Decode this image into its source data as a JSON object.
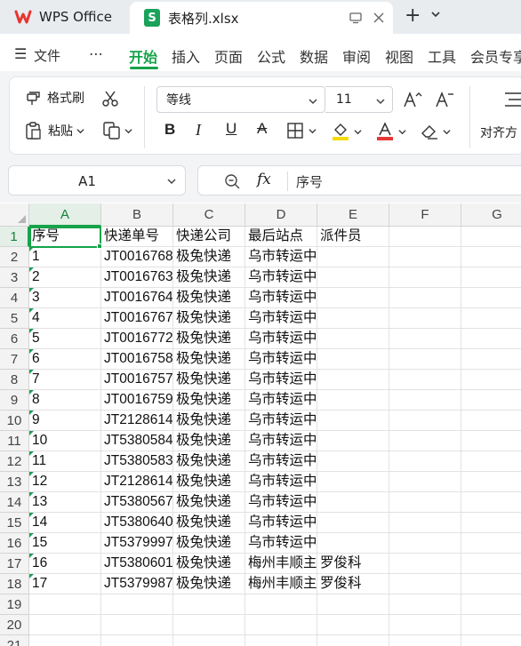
{
  "titlebar": {
    "home_label": "WPS Office",
    "file_tab_label": "表格列.xlsx",
    "sheet_icon_letter": "S"
  },
  "menu": {
    "hamburger": "☰",
    "file": "文件",
    "more": "⋯",
    "items": [
      "开始",
      "插入",
      "页面",
      "公式",
      "数据",
      "审阅",
      "视图",
      "工具",
      "会员专享"
    ],
    "active": "开始"
  },
  "ribbon": {
    "format_painter": "格式刷",
    "paste": "粘贴",
    "font_name": "等线",
    "font_size": "11",
    "bold": "B",
    "italic": "I",
    "underline": "U",
    "strike": "A",
    "align": "对齐方"
  },
  "formula_bar": {
    "cell_ref": "A1",
    "fx": "fx",
    "value": "序号"
  },
  "grid": {
    "columns": [
      "A",
      "B",
      "C",
      "D",
      "E",
      "F",
      "G"
    ],
    "rows": [
      "1",
      "2",
      "3",
      "4",
      "5",
      "6",
      "7",
      "8",
      "9",
      "10",
      "11",
      "12",
      "13",
      "14",
      "15",
      "16",
      "17",
      "18",
      "19",
      "20",
      "21"
    ],
    "cells": [
      [
        "序号",
        "快递单号",
        "快递公司",
        "最后站点",
        "派件员"
      ],
      [
        "1",
        "JT0016768",
        "极兔快递",
        "乌市转运中",
        ""
      ],
      [
        "2",
        "JT0016763",
        "极兔快递",
        "乌市转运中",
        ""
      ],
      [
        "3",
        "JT0016764",
        "极兔快递",
        "乌市转运中",
        ""
      ],
      [
        "4",
        "JT0016767",
        "极兔快递",
        "乌市转运中",
        ""
      ],
      [
        "5",
        "JT0016772",
        "极兔快递",
        "乌市转运中",
        ""
      ],
      [
        "6",
        "JT0016758",
        "极兔快递",
        "乌市转运中",
        ""
      ],
      [
        "7",
        "JT0016757",
        "极兔快递",
        "乌市转运中",
        ""
      ],
      [
        "8",
        "JT0016759",
        "极兔快递",
        "乌市转运中",
        ""
      ],
      [
        "9",
        "JT2128614",
        "极兔快递",
        "乌市转运中",
        ""
      ],
      [
        "10",
        "JT5380584",
        "极兔快递",
        "乌市转运中",
        ""
      ],
      [
        "11",
        "JT5380583",
        "极兔快递",
        "乌市转运中",
        ""
      ],
      [
        "12",
        "JT2128614",
        "极兔快递",
        "乌市转运中",
        ""
      ],
      [
        "13",
        "JT5380567",
        "极兔快递",
        "乌市转运中",
        ""
      ],
      [
        "14",
        "JT5380640",
        "极兔快递",
        "乌市转运中",
        ""
      ],
      [
        "15",
        "JT5379997",
        "极兔快递",
        "乌市转运中",
        ""
      ],
      [
        "16",
        "JT5380601",
        "极兔快递",
        "梅州丰顺主",
        "罗俊科"
      ],
      [
        "17",
        "JT5379987",
        "极兔快递",
        "梅州丰顺主",
        "罗俊科"
      ]
    ]
  },
  "colors": {
    "accent": "#16a34a",
    "wps_red": "#e8352e"
  }
}
